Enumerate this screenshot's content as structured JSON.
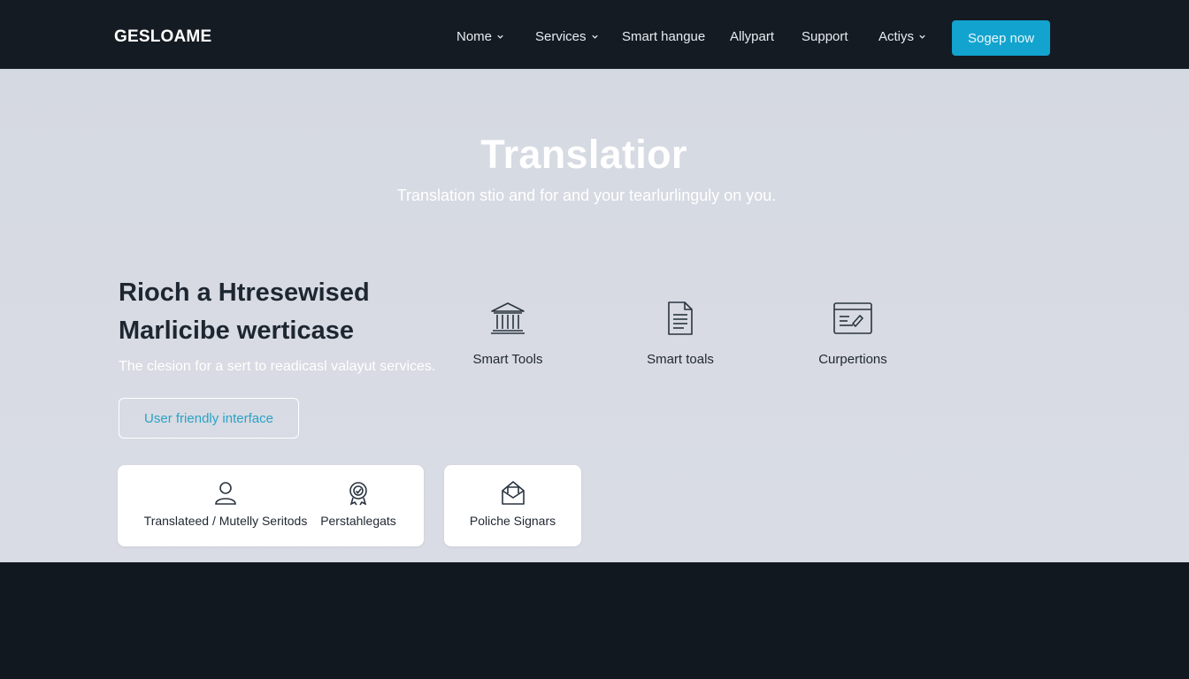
{
  "brand": "GESLOAME",
  "nav": {
    "items": [
      {
        "label": "Nome",
        "has_dropdown": true
      },
      {
        "label": "Services",
        "has_dropdown": true
      },
      {
        "label": "Smart hangue",
        "has_dropdown": false
      },
      {
        "label": "Allypart",
        "has_dropdown": false
      },
      {
        "label": "Support",
        "has_dropdown": false
      },
      {
        "label": "Actiys",
        "has_dropdown": true
      }
    ],
    "cta_label": "Sogер now"
  },
  "hero": {
    "title": "Translatior",
    "subtitle": "Translation stio and for and your tearlurlinguly on you."
  },
  "feature": {
    "heading_line1": "Rioch a Htresewised",
    "heading_line2": "Marlicibe werticase",
    "description": "The clesion for a sert to readicasl valayut services.",
    "button_label": "User friendly interface"
  },
  "tools": [
    {
      "label": "Smart Tools",
      "icon": "bank-icon"
    },
    {
      "label": "Smart toals",
      "icon": "document-icon"
    },
    {
      "label": "Curpertions",
      "icon": "browser-window-icon"
    }
  ],
  "cards": [
    {
      "items": [
        {
          "label": "Translateed / Mutelly Seritods",
          "icon": "user-icon"
        },
        {
          "label": "Perstahlegats",
          "icon": "badge-icon"
        }
      ]
    },
    {
      "items": [
        {
          "label": "Poliche Signars",
          "icon": "envelope-icon"
        }
      ]
    }
  ],
  "colors": {
    "navbar": "#141b22",
    "accent": "#12a3cf",
    "hero_bg": "#d7dae2",
    "footer": "#111820"
  }
}
